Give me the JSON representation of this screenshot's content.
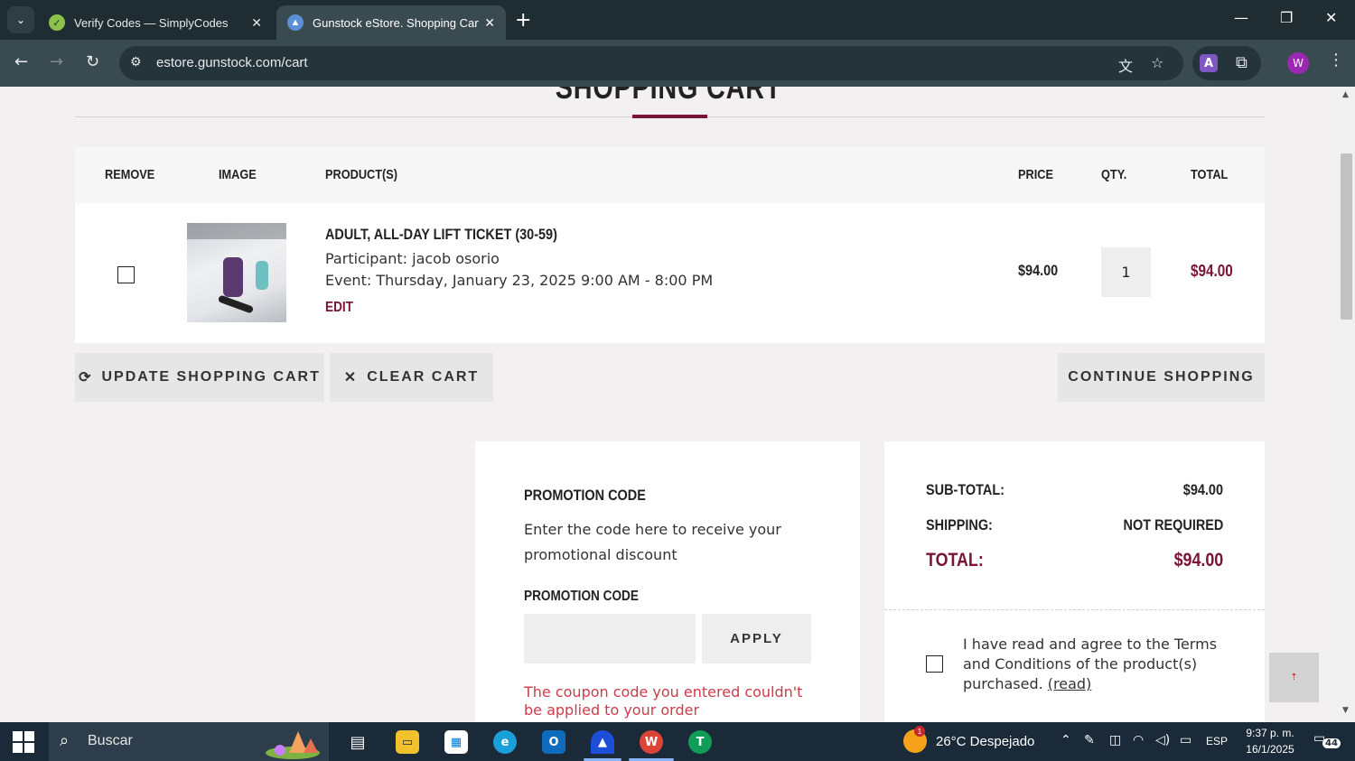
{
  "browser": {
    "tabs": [
      {
        "title": "Verify Codes — SimplyCodes",
        "active": false
      },
      {
        "title": "Gunstock eStore. Shopping Cart",
        "active": true
      }
    ],
    "url": "estore.gunstock.com/cart",
    "profile_initial": "W",
    "extension_letter": "A"
  },
  "page": {
    "title": "SHOPPING CART",
    "table": {
      "headers": {
        "remove": "REMOVE",
        "image": "IMAGE",
        "products": "PRODUCT(S)",
        "price": "PRICE",
        "qty": "QTY.",
        "total": "TOTAL"
      },
      "items": [
        {
          "name": "ADULT, ALL-DAY LIFT TICKET (30-59)",
          "participant": "Participant: jacob osorio",
          "event": "Event: Thursday, January 23, 2025 9:00 AM - 8:00 PM",
          "edit_label": "EDIT",
          "price": "$94.00",
          "qty": "1",
          "total": "$94.00"
        }
      ]
    },
    "buttons": {
      "update": "UPDATE SHOPPING CART",
      "clear": "CLEAR CART",
      "continue": "CONTINUE SHOPPING"
    },
    "promo": {
      "heading": "PROMOTION CODE",
      "description": "Enter the code here to receive your promotional discount",
      "field_label": "PROMOTION CODE",
      "input_value": "",
      "apply_label": "APPLY",
      "error": "The coupon code you entered couldn't be applied to your order"
    },
    "summary": {
      "subtotal_label": "SUB-TOTAL:",
      "subtotal_value": "$94.00",
      "shipping_label": "SHIPPING:",
      "shipping_value": "NOT REQUIRED",
      "total_label": "TOTAL:",
      "total_value": "$94.00",
      "terms_text": "I have read and agree to the Terms and Conditions of the product(s) purchased.",
      "terms_link": "(read)"
    }
  },
  "taskbar": {
    "search_placeholder": "Buscar",
    "weather": "26°C  Despejado",
    "weather_badge": "1",
    "language": "ESP",
    "time": "9:37 p. m.",
    "date": "16/1/2025",
    "notifications": "44"
  },
  "colors": {
    "accent": "#7a1535",
    "error": "#d03a4a",
    "chrome_dark": "#1f2d33"
  }
}
